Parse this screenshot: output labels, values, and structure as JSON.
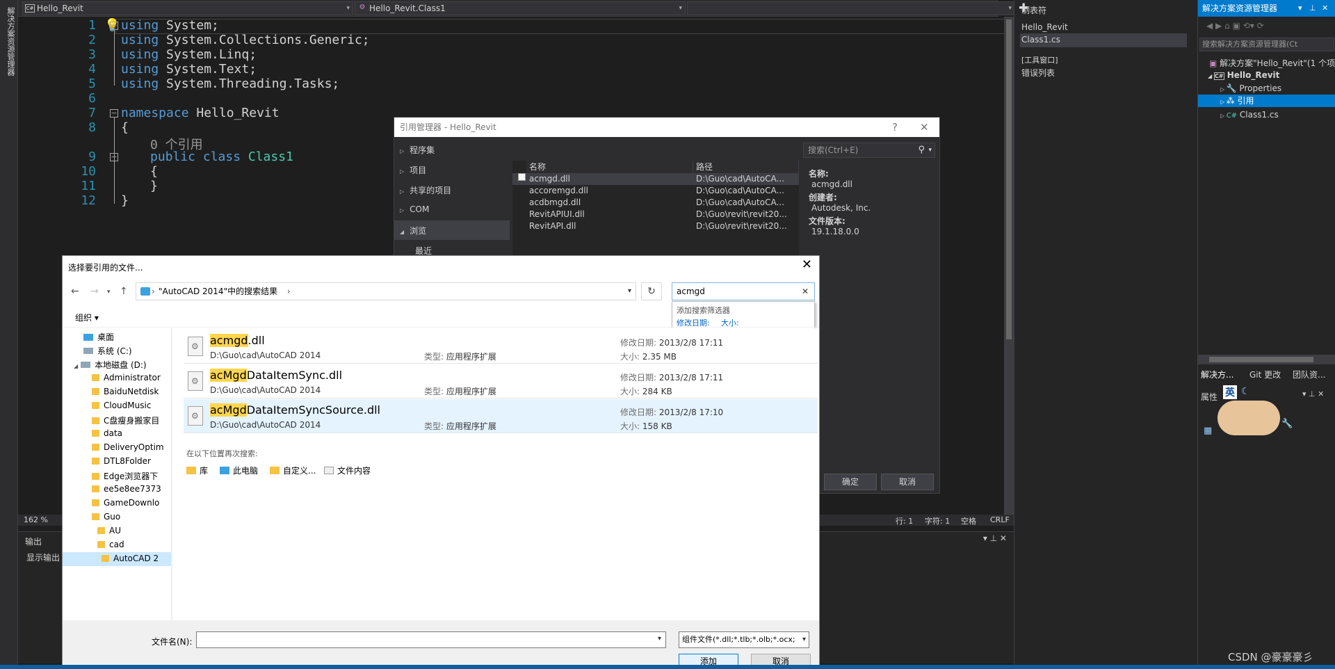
{
  "left_strip": {
    "label": "解决方案资源管理器"
  },
  "nav": {
    "project_combo": "Hello_Revit",
    "class_combo": "Hello_Revit.Class1",
    "member_combo": ""
  },
  "editor": {
    "line_numbers": [
      "1",
      "2",
      "3",
      "4",
      "5",
      "6",
      "7",
      "8",
      "9",
      "10",
      "11",
      "12"
    ],
    "lines": {
      "l1_kw": "using",
      "l1_rest": " System;",
      "l2_kw": "using",
      "l2_rest": " System.Collections.Generic;",
      "l3_kw": "using",
      "l3_rest": " System.Linq;",
      "l4_kw": "using",
      "l4_rest": " System.Text;",
      "l5_kw": "using",
      "l5_rest": " System.Threading.Tasks;",
      "l7_kw": "namespace",
      "l7_rest": " Hello_Revit",
      "l8": "{",
      "codelens": "0 个引用",
      "l9_kw": "public class",
      "l9_type": " Class1",
      "l10": "{",
      "l11": "}",
      "l12": "}"
    },
    "zoom": "162 %"
  },
  "status": {
    "row": "行: 1",
    "char": "字符: 1",
    "space": "空格",
    "eol": "CRLF"
  },
  "output": {
    "title": "输出",
    "show_from": "显示输出"
  },
  "mid": {
    "title": "制表符",
    "items": [
      "Hello_Revit",
      "Class1.cs",
      "[工具窗口]",
      "错误列表"
    ]
  },
  "solution": {
    "title": "解决方案资源管理器",
    "search_placeholder": "搜索解决方案资源管理器(Ct",
    "tree": {
      "solution": "解决方案\"Hello_Revit\"(1 个项",
      "project": "Hello_Revit",
      "properties": "Properties",
      "references": "引用",
      "class1": "Class1.cs"
    },
    "tabs": [
      "解决方...",
      "Git 更改",
      "团队资..."
    ],
    "props_title": "属性",
    "props_ime": "英"
  },
  "refmgr": {
    "title": "引用管理器 - Hello_Revit",
    "help": "?",
    "close": "✕",
    "nav": [
      "程序集",
      "项目",
      "共享的项目",
      "COM",
      "浏览",
      "最近"
    ],
    "search_placeholder": "搜索(Ctrl+E)",
    "columns": [
      "名称",
      "路径"
    ],
    "rows": [
      {
        "name": "acmgd.dll",
        "path": "D:\\Guo\\cad\\AutoCA..."
      },
      {
        "name": "accoremgd.dll",
        "path": "D:\\Guo\\cad\\AutoCA..."
      },
      {
        "name": "acdbmgd.dll",
        "path": "D:\\Guo\\cad\\AutoCA..."
      },
      {
        "name": "RevitAPIUI.dll",
        "path": "D:\\Guo\\revit\\revit20..."
      },
      {
        "name": "RevitAPI.dll",
        "path": "D:\\Guo\\revit\\revit20..."
      }
    ],
    "info": {
      "name_label": "名称:",
      "name_value": "acmgd.dll",
      "creator_label": "创建者:",
      "creator_value": "Autodesk, Inc.",
      "version_label": "文件版本:",
      "version_value": "19.1.18.0.0"
    },
    "ok": "确定",
    "cancel": "取消"
  },
  "filedlg": {
    "title": "选择要引用的文件...",
    "address": "\"AutoCAD 2014\"中的搜索结果",
    "search_value": "acmgd",
    "filter_header": "添加搜索筛选器",
    "filter_date": "修改日期:",
    "filter_size": "大小:",
    "organize": "组织 ▾",
    "tree": [
      "桌面",
      "系统 (C:)",
      "本地磁盘 (D:)",
      "Administrator",
      "BaiduNetdisk",
      "CloudMusic",
      "C盘瘦身搬家目",
      "data",
      "DeliveryOptim",
      "DTL8Folder",
      "Edge浏览器下",
      "ee5e8ee7373",
      "GameDownlo",
      "Guo",
      "AU",
      "cad",
      "AutoCAD 2"
    ],
    "items": [
      {
        "hl": "acmgd",
        "rest": ".dll",
        "path": "D:\\Guo\\cad\\AutoCAD 2014",
        "type_label": "类型:",
        "type": "应用程序扩展",
        "date_label": "修改日期:",
        "date": "2013/2/8 17:11",
        "size_label": "大小:",
        "size": "2.35 MB"
      },
      {
        "hl": "acMgd",
        "rest": "DataItemSync.dll",
        "path": "D:\\Guo\\cad\\AutoCAD 2014",
        "type_label": "类型:",
        "type": "应用程序扩展",
        "date_label": "修改日期:",
        "date": "2013/2/8 17:11",
        "size_label": "大小:",
        "size": "284 KB"
      },
      {
        "hl": "acMgd",
        "rest": "DataItemSyncSource.dll",
        "path": "D:\\Guo\\cad\\AutoCAD 2014",
        "type_label": "类型:",
        "type": "应用程序扩展",
        "date_label": "修改日期:",
        "date": "2013/2/8 17:10",
        "size_label": "大小:",
        "size": "158 KB"
      }
    ],
    "search_again": "在以下位置再次搜索:",
    "locations": [
      "库",
      "此电脑",
      "自定义...",
      "文件内容"
    ],
    "filename_label": "文件名(N):",
    "filename_value": "",
    "filetype": "组件文件(*.dll;*.tlb;*.olb;*.ocx;",
    "add": "添加",
    "cancel": "取消"
  },
  "watermark": "CSDN @豪豪豪彡",
  "colors": {
    "accent": "#007acc",
    "keyword": "#569cd6",
    "type": "#4ec9b0",
    "highlight": "#ffd54f"
  }
}
